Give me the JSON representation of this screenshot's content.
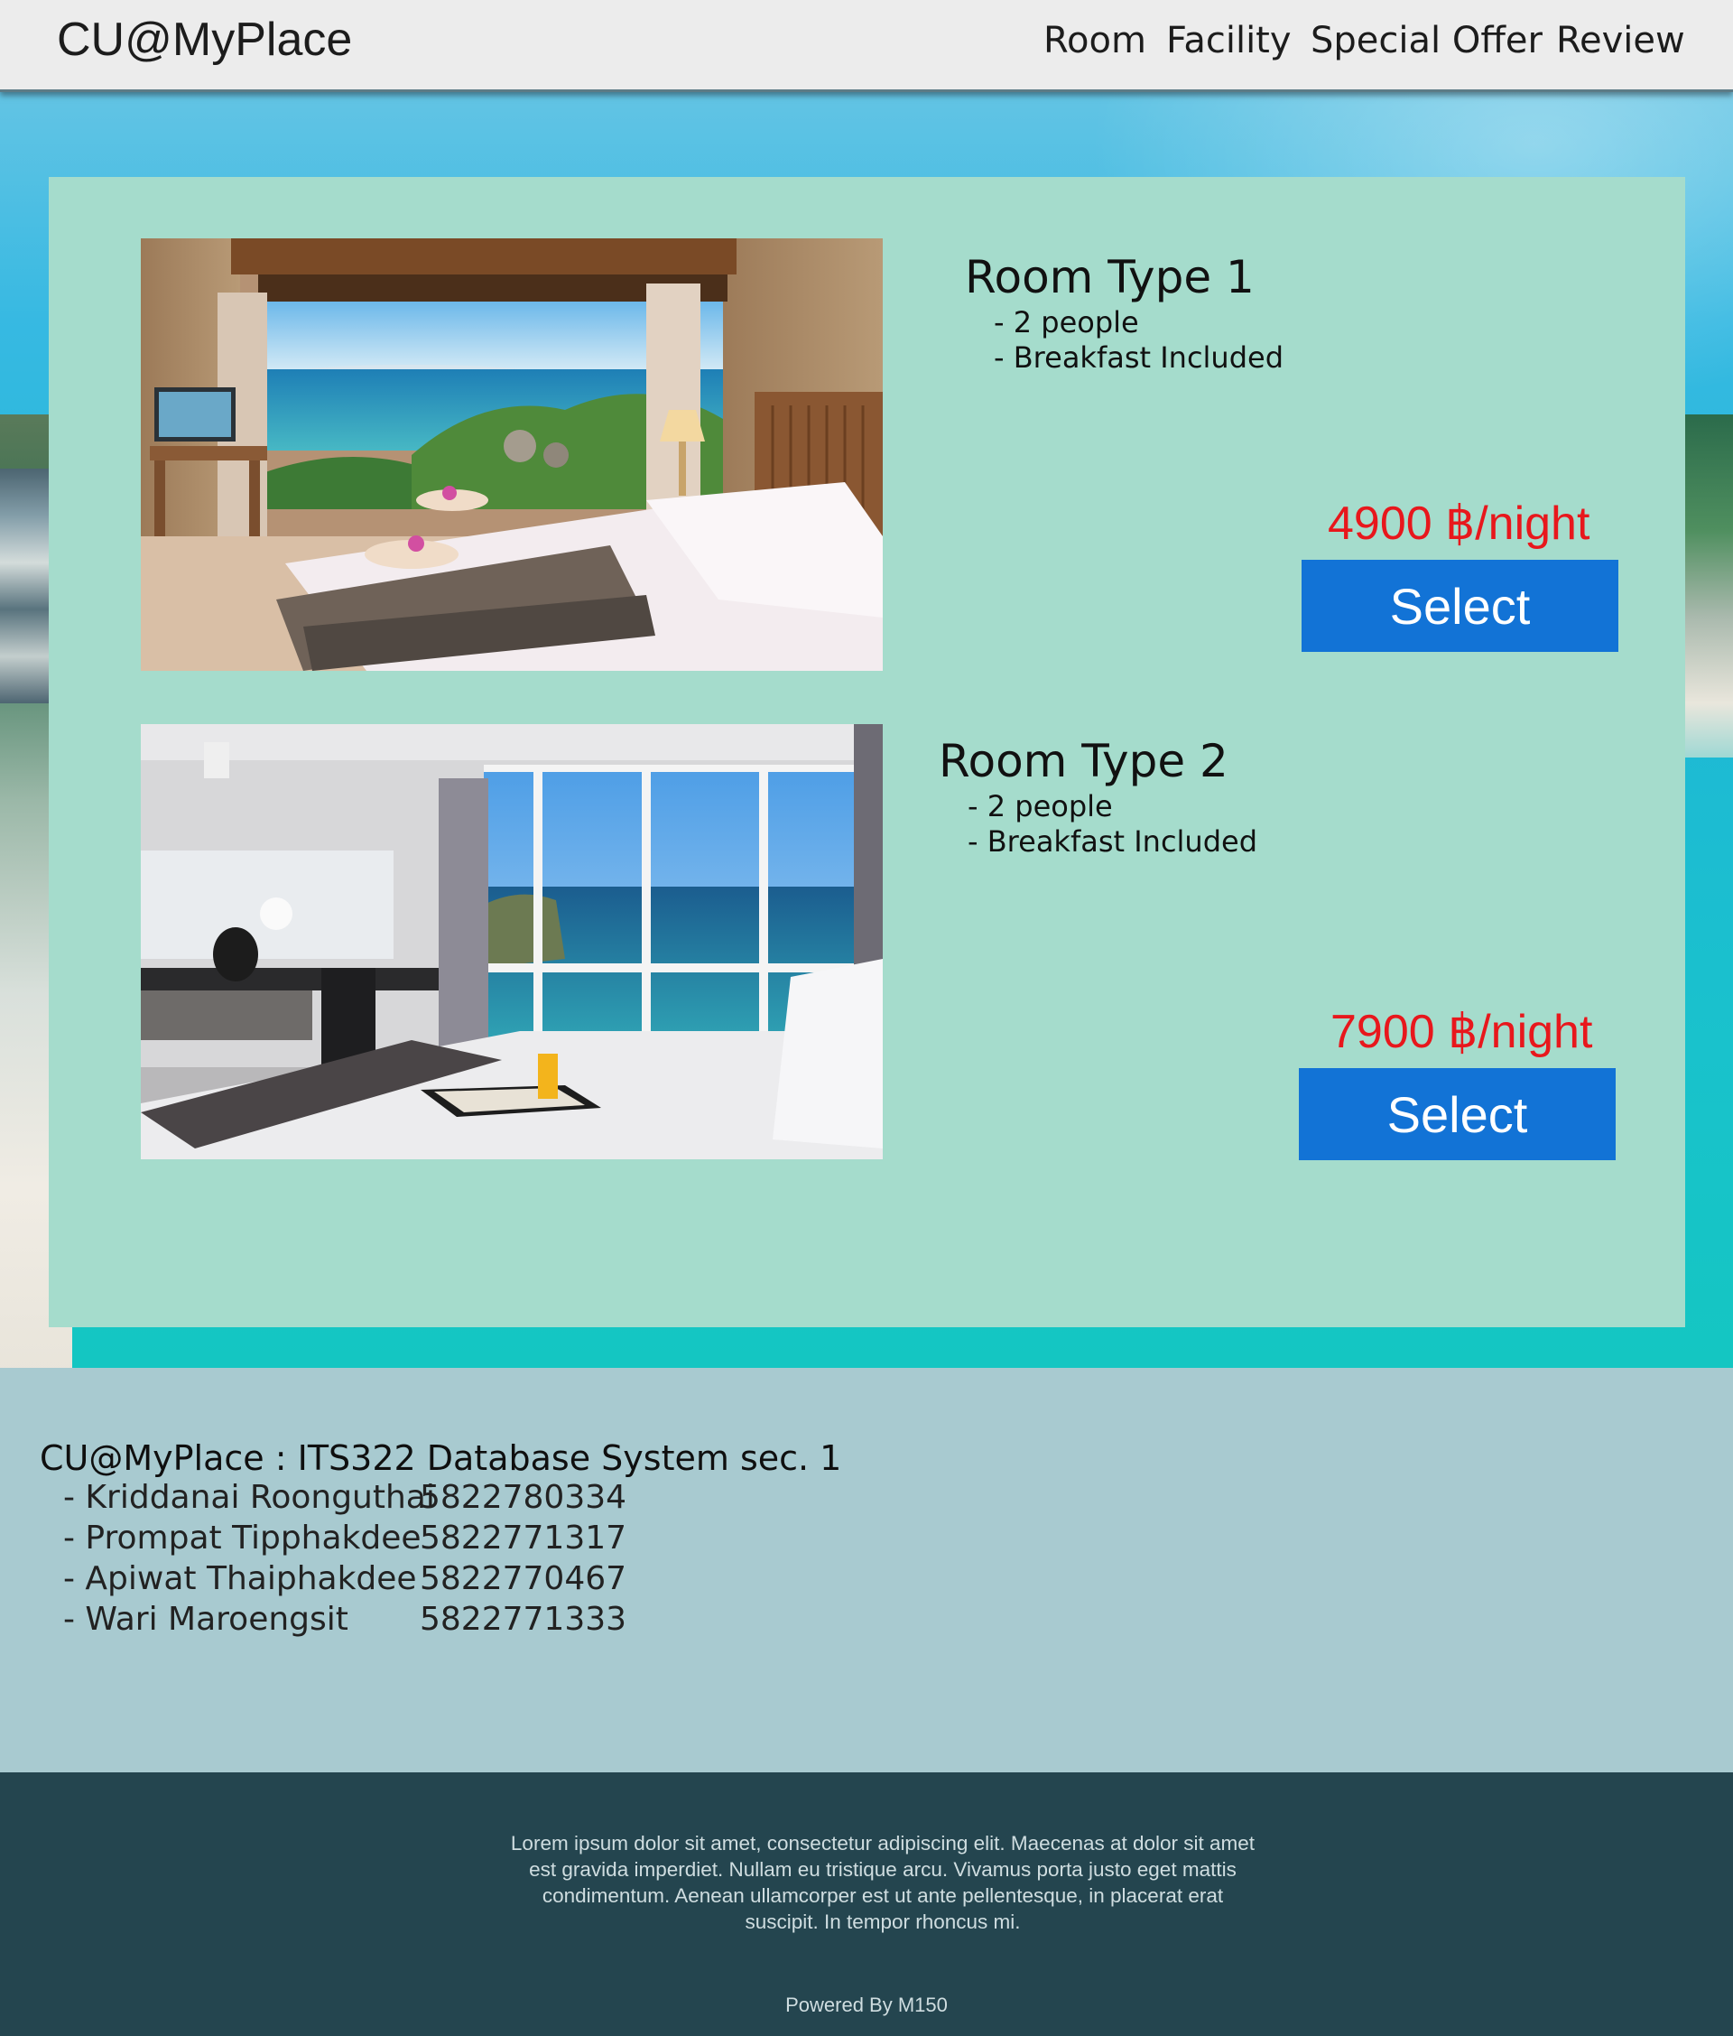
{
  "header": {
    "brand": "CU@MyPlace",
    "nav": [
      "Room",
      "Facility",
      "Special Offer",
      "Review"
    ]
  },
  "rooms": [
    {
      "title": "Room Type 1",
      "features": [
        "- 2 people",
        "- Breakfast Included"
      ],
      "price": "4900 ฿/night",
      "select_label": "Select"
    },
    {
      "title": "Room Type 2",
      "features": [
        "- 2 people",
        "- Breakfast Included"
      ],
      "price": "7900 ฿/night",
      "select_label": "Select"
    }
  ],
  "team": {
    "heading": "CU@MyPlace : ITS322 Database System sec. 1",
    "members": [
      {
        "name": "- Kriddanai Roonguthai",
        "id": "5822780334"
      },
      {
        "name": "- Prompat Tipphakdee",
        "id": "5822771317"
      },
      {
        "name": "- Apiwat Thaiphakdee",
        "id": "5822770467"
      },
      {
        "name": "- Wari Maroengsit",
        "id": "5822771333"
      }
    ]
  },
  "footer": {
    "text": "Lorem ipsum dolor sit amet, consectetur adipiscing elit. Maecenas at dolor sit amet est gravida imperdiet. Nullam eu tristique arcu. Vivamus porta justo eget mattis condimentum. Aenean ullamcorper est ut ante pellentesque, in placerat erat suscipit. In tempor rhoncus mi.",
    "powered": "Powered By M150"
  },
  "colors": {
    "panel": "#a5dccc",
    "price": "#e8171c",
    "button": "#1273d6",
    "team_bg": "#a8cad0",
    "footer_bg": "#24454f"
  }
}
